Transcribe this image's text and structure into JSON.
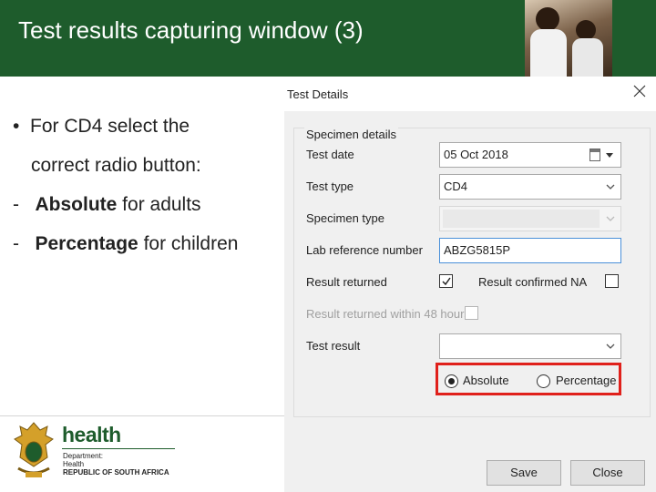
{
  "slide": {
    "title": "Test results capturing window (3)",
    "bullets": {
      "b1_line1": "For CD4 select the",
      "b1_line2": "correct radio button:",
      "b2_bold": "Absolute",
      "b2_rest": " for adults",
      "b3_bold": "Percentage",
      "b3_rest": " for children"
    }
  },
  "logo": {
    "word": "health",
    "line1": "Department:",
    "line2": "Health",
    "line3": "REPUBLIC OF SOUTH AFRICA"
  },
  "dialog": {
    "title": "Test Details",
    "group_label": "Specimen details",
    "fields": {
      "test_date_label": "Test date",
      "test_date_value": "05 Oct  2018",
      "test_type_label": "Test type",
      "test_type_value": "CD4",
      "specimen_type_label": "Specimen type",
      "specimen_type_value": "",
      "lab_ref_label": "Lab reference number",
      "lab_ref_value": "ABZG5815P",
      "result_returned_label": "Result returned",
      "result_returned_checked": true,
      "result_confirmed_na_label": "Result confirmed NA",
      "result_confirmed_na_checked": false,
      "returned_48h_label": "Result returned within 48 hours",
      "returned_48h_checked": false,
      "test_result_label": "Test result",
      "test_result_value": ""
    },
    "radios": {
      "absolute_label": "Absolute",
      "percentage_label": "Percentage",
      "selected": "Absolute"
    },
    "buttons": {
      "save": "Save",
      "close": "Close"
    }
  },
  "colors": {
    "banner": "#1e5c2c",
    "highlight": "#e0201b",
    "dialog_bg": "#f0f0f0"
  }
}
